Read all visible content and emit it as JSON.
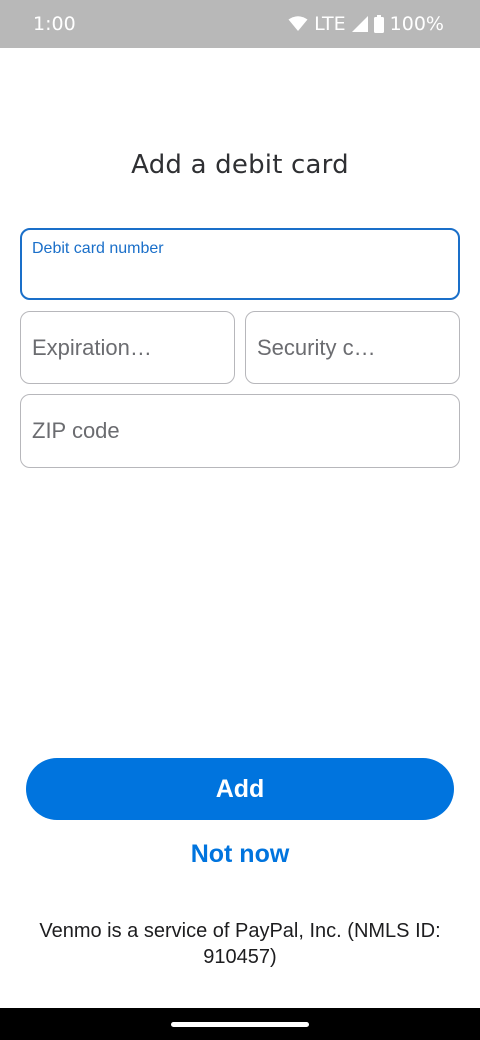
{
  "status_bar": {
    "time": "1:00",
    "network": "LTE",
    "battery": "100%",
    "icons": [
      "wifi-icon",
      "signal-icon",
      "battery-icon"
    ]
  },
  "title": "Add a debit card",
  "fields": {
    "card_number": {
      "label": "Debit card number",
      "value": ""
    },
    "expiration": {
      "placeholder": "Expiration…"
    },
    "security_code": {
      "placeholder": "Security c…"
    },
    "zip": {
      "placeholder": "ZIP code"
    }
  },
  "actions": {
    "add_label": "Add",
    "not_now_label": "Not now"
  },
  "footer": "Venmo is a service of PayPal, Inc. (NMLS ID: 910457)",
  "colors": {
    "accent": "#0074de",
    "focus": "#1a6fc9",
    "status_bar_bg": "#b8b8b8"
  }
}
